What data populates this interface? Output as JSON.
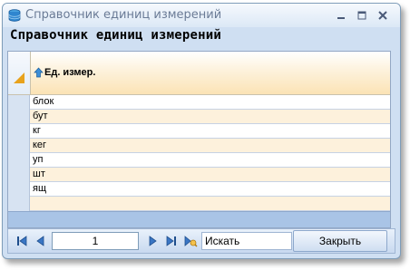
{
  "window": {
    "title": "Справочник единиц измерений"
  },
  "heading": "Справочник единиц измерений",
  "grid": {
    "column_header": "Ед. измер.",
    "rows": [
      "блок",
      "бут",
      "кг",
      "кег",
      "уп",
      "шт",
      "ящ"
    ]
  },
  "navigator": {
    "page_value": "1",
    "search_text": "Искать",
    "close_label": "Закрыть"
  },
  "icons": {
    "app": "database-icon",
    "minimize": "minimize-icon",
    "maximize": "maximize-icon",
    "close": "close-icon",
    "sort": "sort-ascending-icon"
  },
  "colors": {
    "title_text": "#6a7b96",
    "header_accent": "#e8a21c",
    "footer": "#a9c4e6"
  }
}
